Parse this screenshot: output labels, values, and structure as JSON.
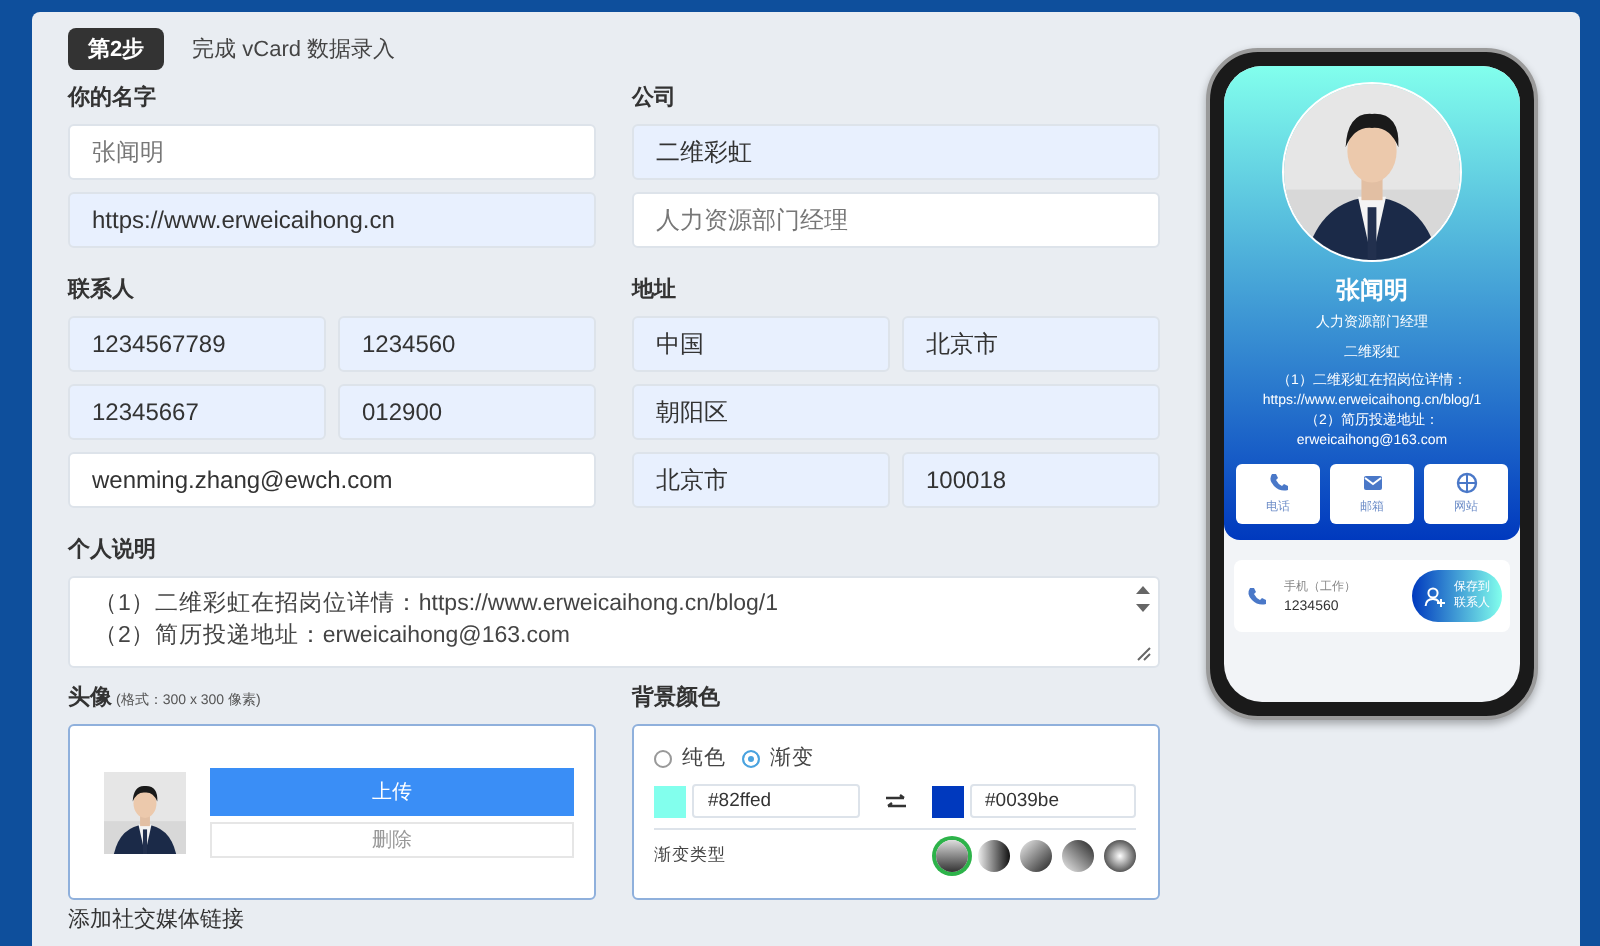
{
  "step": {
    "badge": "第2步",
    "title": "完成 vCard 数据录入"
  },
  "name_section": {
    "label": "你的名字",
    "fields": [
      {
        "placeholder": "张闻明"
      },
      {
        "value": "https://www.erweicaihong.cn",
        "autofilled": true
      }
    ]
  },
  "company_section": {
    "label": "公司",
    "fields": [
      {
        "value": "二维彩虹",
        "autofilled": true
      },
      {
        "placeholder": "人力资源部门经理"
      }
    ]
  },
  "contact_section": {
    "label": "联系人",
    "rows": [
      [
        {
          "value": "1234567789",
          "autofilled": true
        },
        {
          "value": "1234560",
          "autofilled": true
        }
      ],
      [
        {
          "value": "12345667",
          "autofilled": true
        },
        {
          "value": "012900",
          "autofilled": true
        }
      ],
      [
        {
          "value": "wenming.zhang@ewch.com",
          "autofilled": false
        }
      ]
    ]
  },
  "address_section": {
    "label": "地址",
    "rows": [
      [
        {
          "value": "中国",
          "autofilled": true
        },
        {
          "value": "北京市",
          "autofilled": true
        }
      ],
      [
        {
          "value": "朝阳区",
          "autofilled": true
        }
      ],
      [
        {
          "value": "北京市",
          "autofilled": true
        },
        {
          "value": "100018",
          "autofilled": true
        }
      ]
    ]
  },
  "description": {
    "label": "个人说明",
    "lines": [
      "（1）二维彩虹在招岗位详情：https://www.erweicaihong.cn/blog/1",
      "（2）简历投递地址：erweicaihong@163.com"
    ]
  },
  "avatar": {
    "label": "头像",
    "hint": "(格式：300 x 300 像素)",
    "upload_button": "上传",
    "delete_button": "删除"
  },
  "background_color": {
    "label": "背景颜色",
    "modes": [
      {
        "label": "纯色",
        "selected": false
      },
      {
        "label": "渐变",
        "selected": true
      }
    ],
    "color_1": {
      "color": "#82ffed",
      "value": "#82ffed"
    },
    "color_2": {
      "color": "#0039be",
      "value": "#0039be"
    },
    "gradient_type_label": "渐变类型",
    "gradient_types": [
      {
        "kind": "vertical",
        "selected": true
      },
      {
        "kind": "horizontal",
        "selected": false
      },
      {
        "kind": "diagonal",
        "selected": false
      },
      {
        "kind": "diagonal-reverse",
        "selected": false
      },
      {
        "kind": "radial",
        "selected": false
      }
    ]
  },
  "next_section": {
    "label": "添加社交媒体链接"
  },
  "phone_preview": {
    "name": "张闻明",
    "title": "人力资源部门经理",
    "company": "二维彩虹",
    "description": [
      "（1）二维彩虹在招岗位详情：",
      "https://www.erweicaihong.cn/blog/1",
      "（2）简历投递地址：",
      "erweicaihong@163.com"
    ],
    "actions": [
      {
        "kind": "phone",
        "label": "电话"
      },
      {
        "kind": "mail",
        "label": "邮箱"
      },
      {
        "kind": "web",
        "label": "网站"
      }
    ],
    "contact": {
      "label": "手机（工作）",
      "value": "1234560"
    },
    "save_button": [
      "保存到",
      "联系人"
    ]
  }
}
